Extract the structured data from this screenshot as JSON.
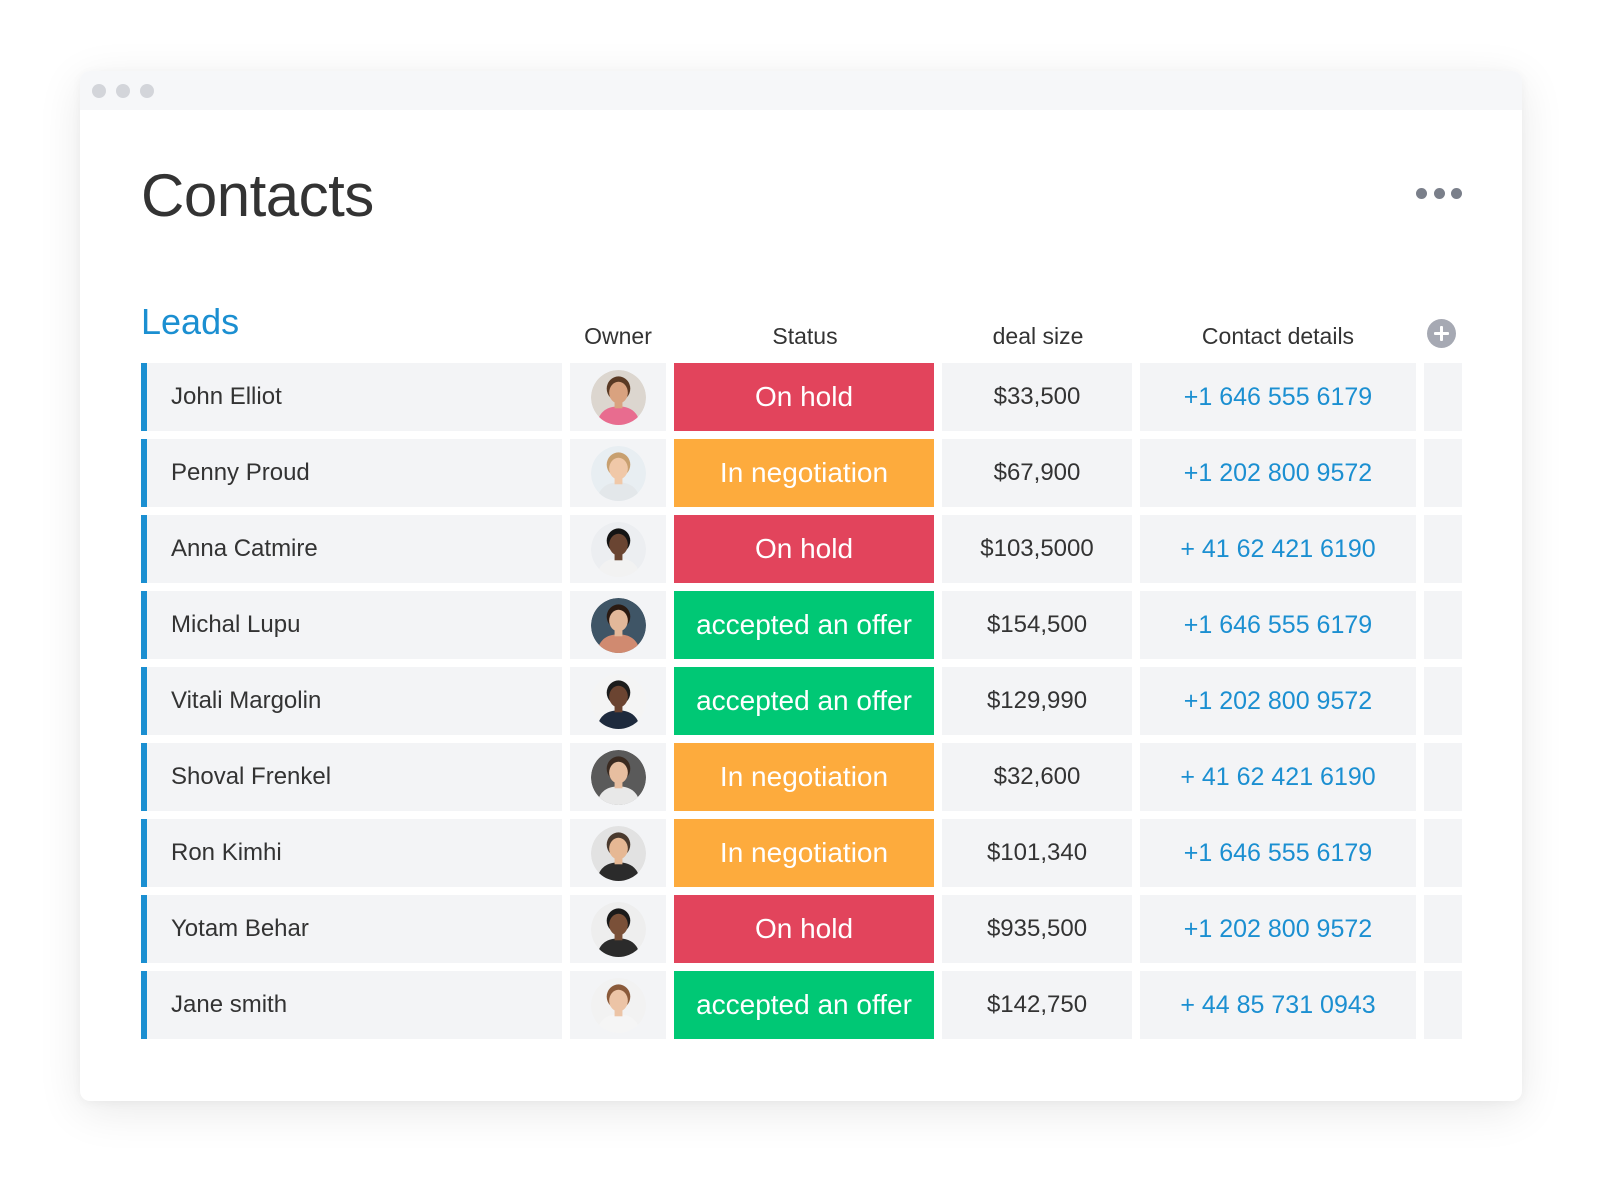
{
  "page": {
    "title": "Contacts",
    "group_title": "Leads"
  },
  "columns": {
    "owner": "Owner",
    "status": "Status",
    "deal_size": "deal size",
    "contact_details": "Contact details"
  },
  "colors": {
    "accent": "#1b8fd1",
    "status": {
      "On hold": "#e2445c",
      "In negotiation": "#fdab3d",
      "accepted an offer": "#00c875"
    }
  },
  "rows": [
    {
      "name": "John Elliot",
      "status": "On hold",
      "deal": "$33,500",
      "contact": "+1 646 555 6179",
      "avatar": {
        "bg": "#dcd6cf",
        "skin": "#d9a27f",
        "hair": "#5a3a24",
        "shirt": "#e86c8f"
      }
    },
    {
      "name": "Penny Proud",
      "status": "In negotiation",
      "deal": "$67,900",
      "contact": "+1 202 800 9572",
      "avatar": {
        "bg": "#e8eef2",
        "skin": "#f0c8a8",
        "hair": "#c8a070",
        "shirt": "#e3e7ea"
      }
    },
    {
      "name": "Anna Catmire",
      "status": "On hold",
      "deal": "$103,5000",
      "contact": "+ 41 62 421 6190",
      "avatar": {
        "bg": "#eceef1",
        "skin": "#6a4532",
        "hair": "#141414",
        "shirt": "#f2f2f2"
      }
    },
    {
      "name": "Michal Lupu",
      "status": "accepted an offer",
      "deal": "$154,500",
      "contact": "+1 646 555 6179",
      "avatar": {
        "bg": "#3f5566",
        "skin": "#e2b89a",
        "hair": "#2a1a12",
        "shirt": "#d08a70"
      }
    },
    {
      "name": "Vitali Margolin",
      "status": "accepted an offer",
      "deal": "$129,990",
      "contact": "+1 202 800 9572",
      "avatar": {
        "bg": "#f4f4f4",
        "skin": "#6b4431",
        "hair": "#1c1c1c",
        "shirt": "#1e2a3d"
      }
    },
    {
      "name": "Shoval Frenkel",
      "status": "In negotiation",
      "deal": "$32,600",
      "contact": "+ 41 62 421 6190",
      "avatar": {
        "bg": "#5a5a5a",
        "skin": "#e7bea0",
        "hair": "#3a2a20",
        "shirt": "#e8e8e8"
      }
    },
    {
      "name": "Ron Kimhi",
      "status": "In negotiation",
      "deal": "$101,340",
      "contact": "+1 646 555 6179",
      "avatar": {
        "bg": "#e2e2e2",
        "skin": "#e6b894",
        "hair": "#4a3a2e",
        "shirt": "#2b2b2b"
      }
    },
    {
      "name": "Yotam Behar",
      "status": "On hold",
      "deal": "$935,500",
      "contact": "+1 202 800 9572",
      "avatar": {
        "bg": "#eeeeee",
        "skin": "#7a5038",
        "hair": "#1a1a1a",
        "shirt": "#2b2b2b"
      }
    },
    {
      "name": "Jane smith",
      "status": "accepted an offer",
      "deal": "$142,750",
      "contact": "+ 44 85 731 0943",
      "avatar": {
        "bg": "#f2f2f2",
        "skin": "#ecc4a6",
        "hair": "#8a5a3a",
        "shirt": "#f5f5f5"
      }
    }
  ]
}
